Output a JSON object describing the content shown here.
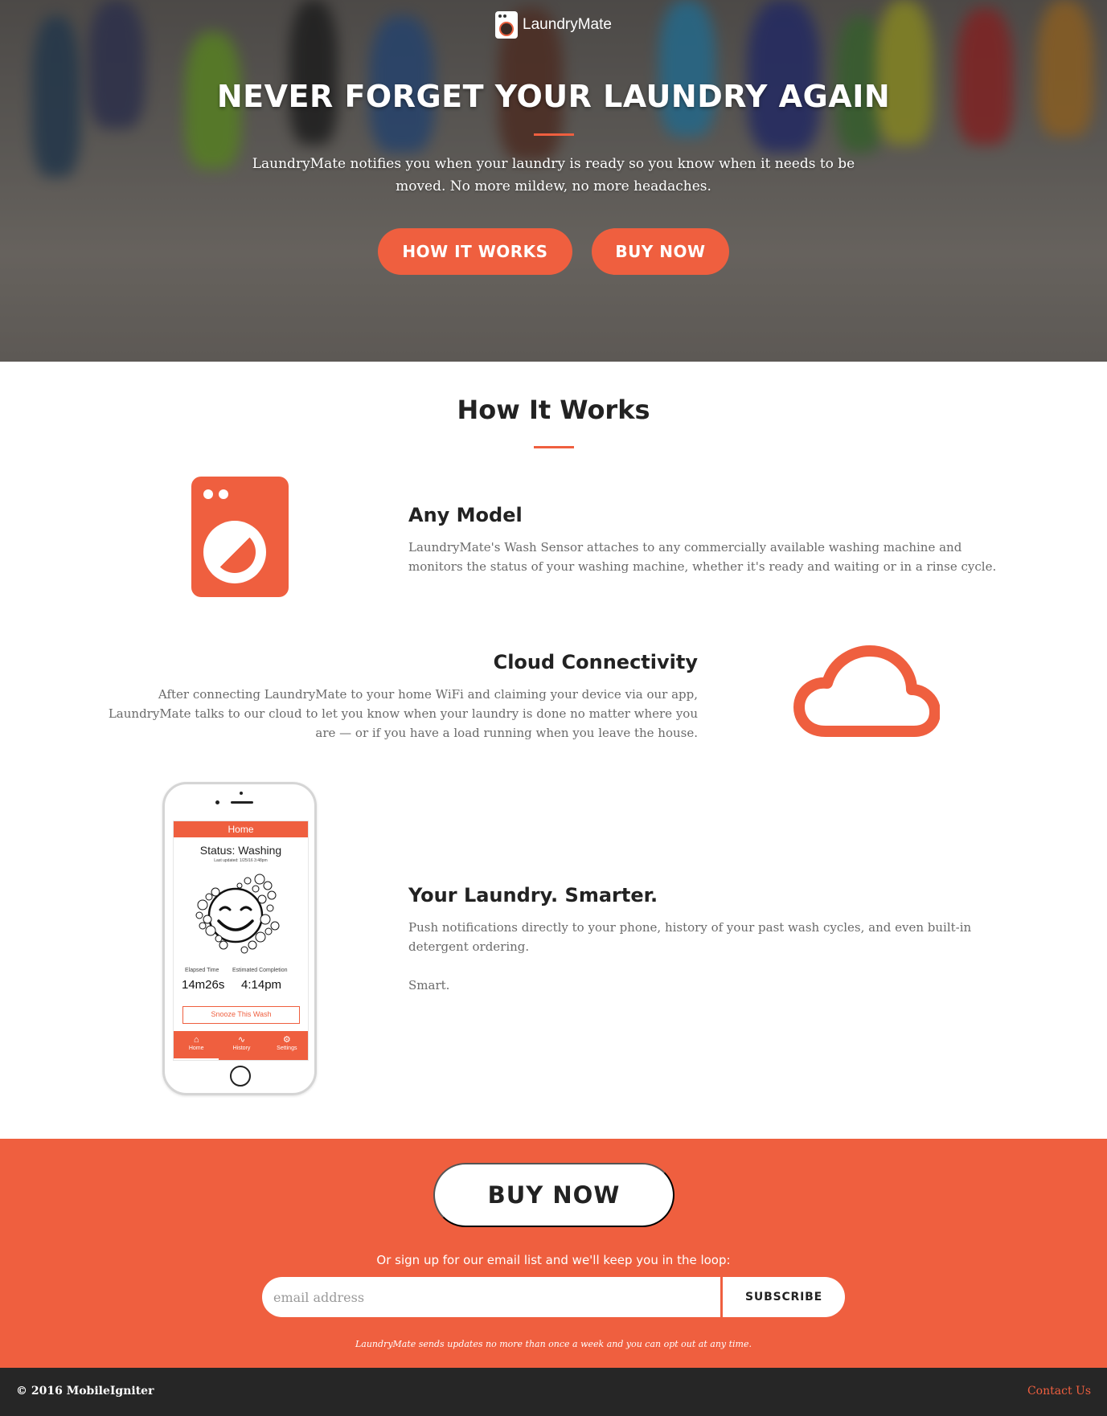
{
  "colors": {
    "accent": "#ef5f3f",
    "footer_bg": "#262626",
    "text": "#222222",
    "muted_text": "#6a6a6a"
  },
  "hero": {
    "brand_name": "LaundryMate",
    "brand_icon": "laundrymate-logo-icon",
    "title": "NEVER FORGET YOUR LAUNDRY AGAIN",
    "subtitle": "LaundryMate notifies you when your laundry is ready so you know when it needs to be moved. No more mildew, no more headaches.",
    "buttons": {
      "how_it_works": "HOW IT WORKS",
      "buy_now": "BUY NOW"
    }
  },
  "how_it_works": {
    "title": "How It Works",
    "features": [
      {
        "icon": "washing-machine-icon",
        "title": "Any Model",
        "text": "LaundryMate's Wash Sensor attaches to any commercially available washing machine and monitors the status of your washing machine, whether it's ready and waiting or in a rinse cycle."
      },
      {
        "icon": "cloud-icon",
        "title": "Cloud Connectivity",
        "text": "After connecting LaundryMate to your home WiFi and claiming your device via our app, LaundryMate talks to our cloud to let you know when your laundry is done no matter where you are — or if you have a load running when you leave the house."
      },
      {
        "icon": "phone-app-icon",
        "title": "Your Laundry. Smarter.",
        "text": "Push notifications directly to your phone, history of your past wash cycles, and even built-in detergent ordering.",
        "text2": "Smart."
      }
    ],
    "phone": {
      "header": "Home",
      "status": "Status: Washing",
      "updated": "Last updated: 1/25/16 3:48pm",
      "elapsed_label": "Elapsed Time",
      "elapsed_value": "14m26s",
      "completion_label": "Estimated Completion",
      "completion_value": "4:14pm",
      "snooze": "Snooze This Wash",
      "tabs": [
        {
          "label": "Home",
          "icon": "home-icon"
        },
        {
          "label": "History",
          "icon": "pulse-icon"
        },
        {
          "label": "Settings",
          "icon": "gear-icon"
        }
      ]
    }
  },
  "cta": {
    "buy_now": "BUY NOW",
    "signup_text": "Or sign up for our email list and we'll keep you in the loop:",
    "email_placeholder": "email address",
    "subscribe": "SUBSCRIBE",
    "note": "LaundryMate sends updates no more than once a week and you can opt out at any time."
  },
  "footer": {
    "copyright": "© 2016 MobileIgniter",
    "contact": "Contact Us"
  }
}
